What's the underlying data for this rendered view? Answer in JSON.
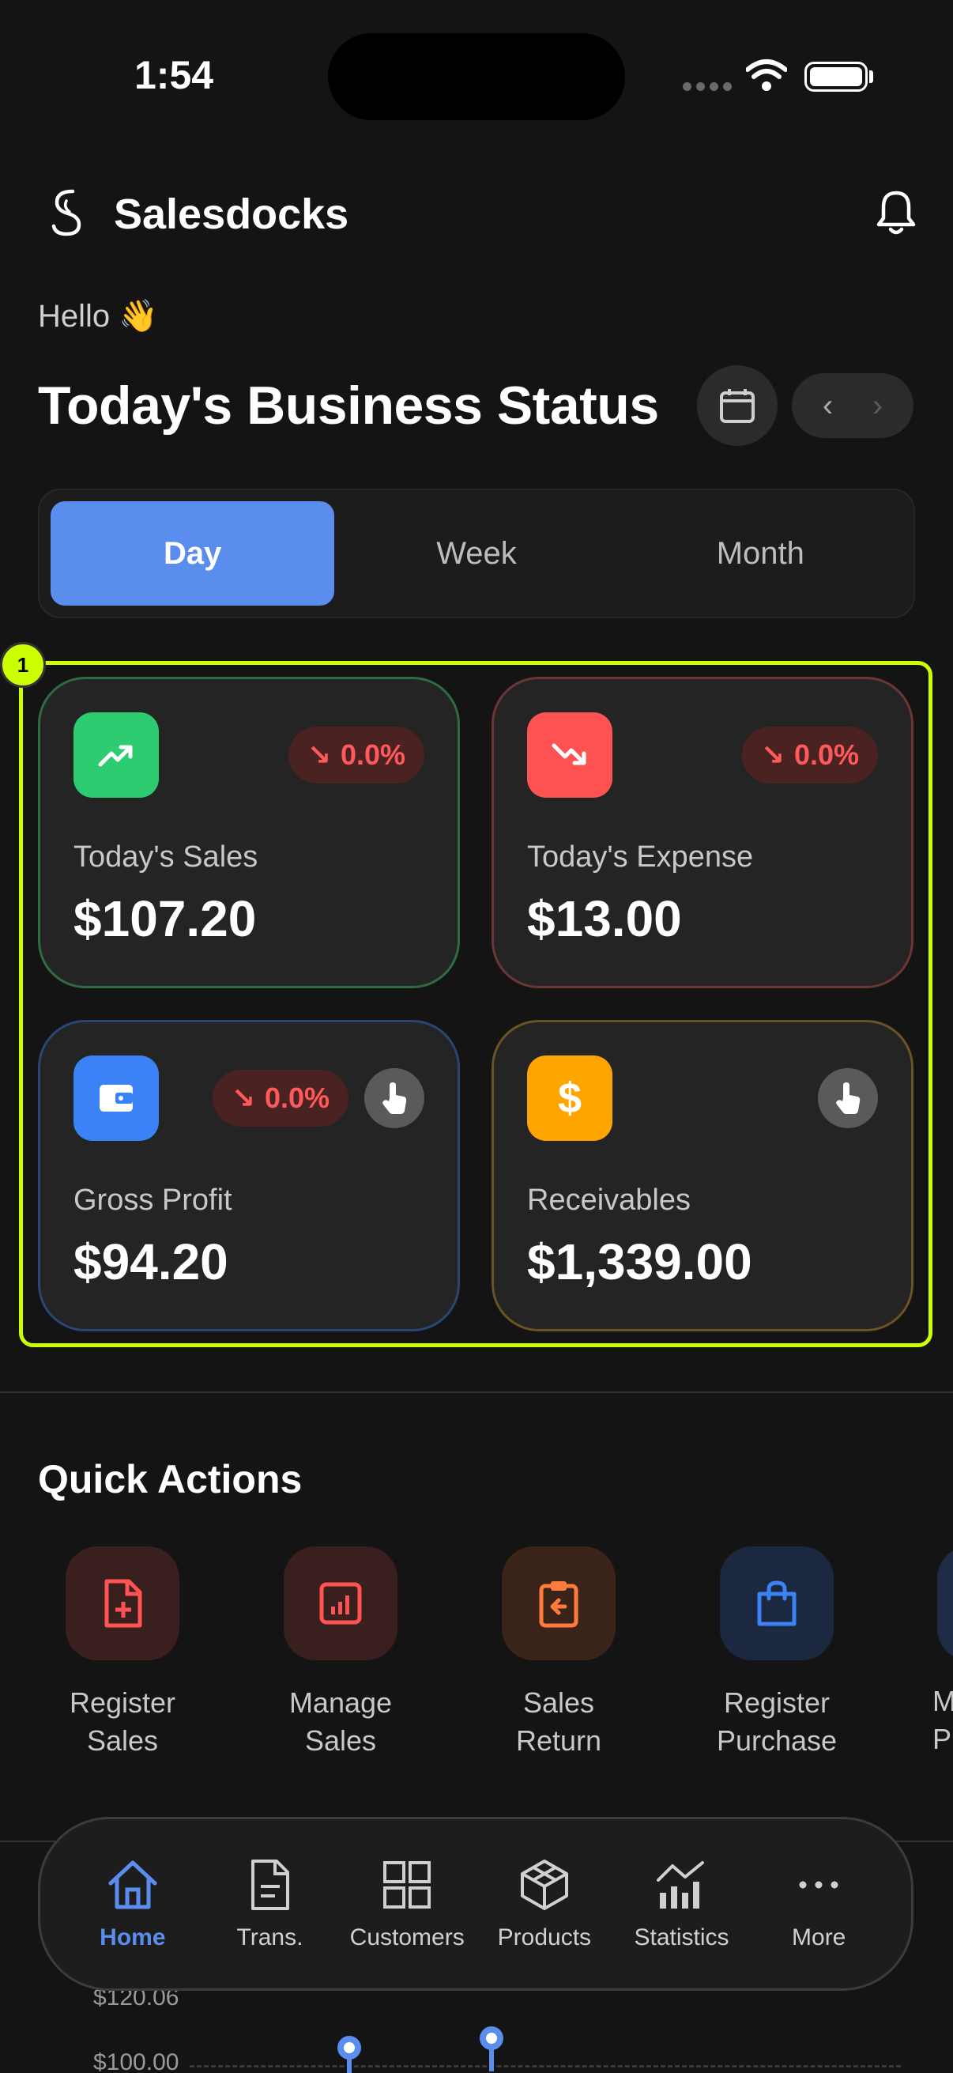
{
  "status_bar": {
    "time": "1:54"
  },
  "header": {
    "brand": "Salesdocks"
  },
  "greeting": "Hello 👋",
  "title": "Today's Business Status",
  "date_nav": {
    "prev": "‹",
    "next": "›"
  },
  "period_tabs": [
    {
      "label": "Day",
      "active": true
    },
    {
      "label": "Week",
      "active": false
    },
    {
      "label": "Month",
      "active": false
    }
  ],
  "highlight_badge": "1",
  "cards": {
    "sales": {
      "label": "Today's Sales",
      "value": "$107.20",
      "change": "0.0%",
      "arrow": "↘",
      "color": "#2ecc71"
    },
    "expense": {
      "label": "Today's Expense",
      "value": "$13.00",
      "change": "0.0%",
      "arrow": "↘",
      "color": "#ff5252"
    },
    "profit": {
      "label": "Gross Profit",
      "value": "$94.20",
      "change": "0.0%",
      "arrow": "↘",
      "color": "#3b82f6"
    },
    "receivables": {
      "label": "Receivables",
      "value": "$1,339.00",
      "color": "#ffa500"
    }
  },
  "quick_actions": {
    "title": "Quick Actions",
    "items": [
      {
        "label": "Register\nSales",
        "icon": "file-plus-icon"
      },
      {
        "label": "Manage\nSales",
        "icon": "report-chart-icon"
      },
      {
        "label": "Sales\nReturn",
        "icon": "clipboard-return-icon"
      },
      {
        "label": "Register\nPurchase",
        "icon": "shopping-bag-icon"
      }
    ],
    "partial_label": "M\nP"
  },
  "chart_peek": {
    "ticks": [
      "$120.06",
      "$100.00"
    ]
  },
  "bottom_nav": [
    {
      "label": "Home",
      "active": true
    },
    {
      "label": "Trans.",
      "active": false
    },
    {
      "label": "Customers",
      "active": false
    },
    {
      "label": "Products",
      "active": false
    },
    {
      "label": "Statistics",
      "active": false
    },
    {
      "label": "More",
      "active": false
    }
  ]
}
